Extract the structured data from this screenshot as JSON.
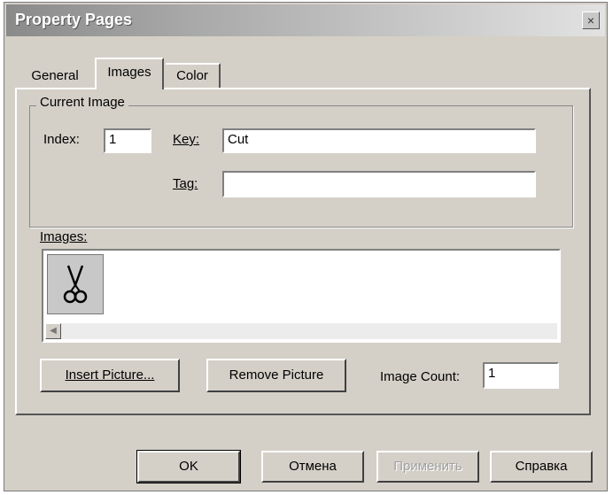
{
  "window": {
    "title": "Property Pages",
    "close_glyph": "×"
  },
  "tabs": [
    {
      "label": "General",
      "active": false
    },
    {
      "label": "Images",
      "active": true
    },
    {
      "label": "Color",
      "active": false
    }
  ],
  "current_image": {
    "group_label": "Current Image",
    "index_label": "Index:",
    "index_value": "1",
    "key_label": "Key:",
    "key_value": "Cut",
    "tag_label": "Tag:",
    "tag_value": ""
  },
  "images": {
    "label": "Images:",
    "items": [
      {
        "icon": "scissors-icon"
      }
    ]
  },
  "actions": {
    "insert_label": "Insert Picture...",
    "remove_label": "Remove Picture",
    "count_label": "Image Count:",
    "count_value": "1"
  },
  "footer": {
    "ok_label": "OK",
    "cancel_label": "Отмена",
    "apply_label": "Применить",
    "help_label": "Справка"
  }
}
